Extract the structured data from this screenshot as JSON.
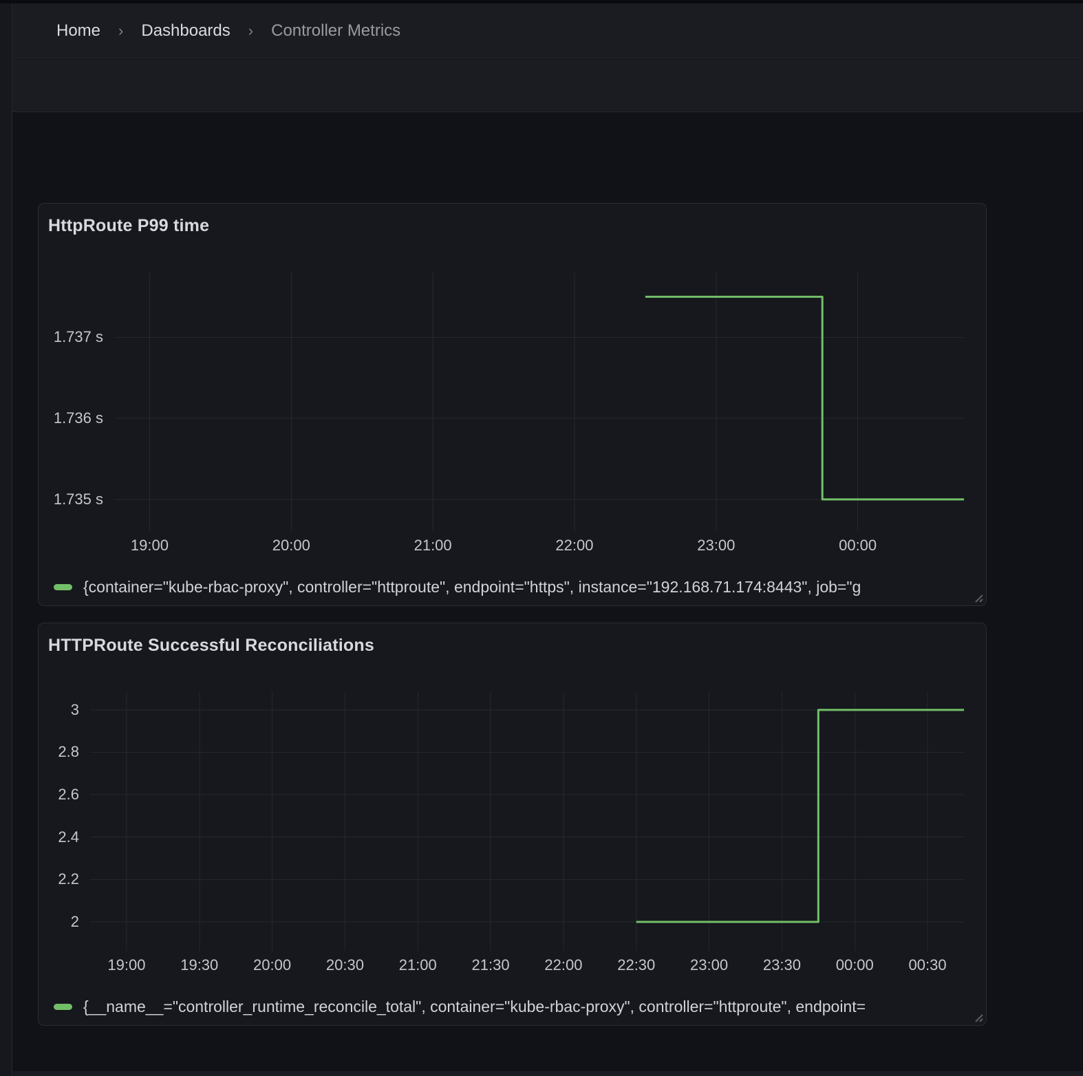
{
  "breadcrumb": {
    "separator": "›",
    "items": [
      {
        "label": "Home"
      },
      {
        "label": "Dashboards"
      },
      {
        "label": "Controller Metrics"
      }
    ]
  },
  "colors": {
    "series_green": "#73BF69",
    "page_bg": "#111217",
    "panel_bg": "#16181d",
    "panel_border": "#2a2c33",
    "grid_line": "rgba(208,216,235,0.08)"
  },
  "chart_data": [
    {
      "type": "line",
      "step": true,
      "title": "HttpRoute P99 time",
      "legend": "{container=\"kube-rbac-proxy\", controller=\"httproute\", endpoint=\"https\", instance=\"192.168.71.174:8443\", job=\"g",
      "line_color": "#73BF69",
      "grid": true,
      "legend_position": "bottom",
      "x_unit": "time",
      "x_range_hours": [
        18.75,
        24.75
      ],
      "y_range": [
        1.73466,
        1.7378
      ],
      "y_ticks": [
        {
          "v": 1.735,
          "label": "1.735 s"
        },
        {
          "v": 1.736,
          "label": "1.736 s"
        },
        {
          "v": 1.737,
          "label": "1.737 s"
        }
      ],
      "x_ticks": [
        {
          "t": 19,
          "label": "19:00"
        },
        {
          "t": 20,
          "label": "20:00"
        },
        {
          "t": 21,
          "label": "21:00"
        },
        {
          "t": 22,
          "label": "22:00"
        },
        {
          "t": 23,
          "label": "23:00"
        },
        {
          "t": 24,
          "label": "00:00"
        }
      ],
      "points": [
        {
          "t": 22.5,
          "v": 1.7375
        },
        {
          "t": 23.75,
          "v": 1.7375
        },
        {
          "t": 23.75,
          "v": 1.735
        },
        {
          "t": 24.75,
          "v": 1.735
        }
      ]
    },
    {
      "type": "line",
      "step": true,
      "title": "HTTPRoute Successful Reconciliations",
      "legend": "{__name__=\"controller_runtime_reconcile_total\", container=\"kube-rbac-proxy\", controller=\"httproute\", endpoint=",
      "line_color": "#73BF69",
      "grid": true,
      "legend_position": "bottom",
      "x_unit": "time",
      "x_range_hours": [
        18.75,
        24.75
      ],
      "y_range": [
        1.883,
        3.084
      ],
      "y_ticks": [
        {
          "v": 2,
          "label": "2"
        },
        {
          "v": 2.2,
          "label": "2.2"
        },
        {
          "v": 2.4,
          "label": "2.4"
        },
        {
          "v": 2.6,
          "label": "2.6"
        },
        {
          "v": 2.8,
          "label": "2.8"
        },
        {
          "v": 3,
          "label": "3"
        }
      ],
      "x_ticks": [
        {
          "t": 19,
          "label": "19:00"
        },
        {
          "t": 19.5,
          "label": "19:30"
        },
        {
          "t": 20,
          "label": "20:00"
        },
        {
          "t": 20.5,
          "label": "20:30"
        },
        {
          "t": 21,
          "label": "21:00"
        },
        {
          "t": 21.5,
          "label": "21:30"
        },
        {
          "t": 22,
          "label": "22:00"
        },
        {
          "t": 22.5,
          "label": "22:30"
        },
        {
          "t": 23,
          "label": "23:00"
        },
        {
          "t": 23.5,
          "label": "23:30"
        },
        {
          "t": 24,
          "label": "00:00"
        },
        {
          "t": 24.5,
          "label": "00:30"
        }
      ],
      "points": [
        {
          "t": 22.5,
          "v": 2
        },
        {
          "t": 23.75,
          "v": 2
        },
        {
          "t": 23.75,
          "v": 3
        },
        {
          "t": 24.75,
          "v": 3
        }
      ]
    }
  ]
}
